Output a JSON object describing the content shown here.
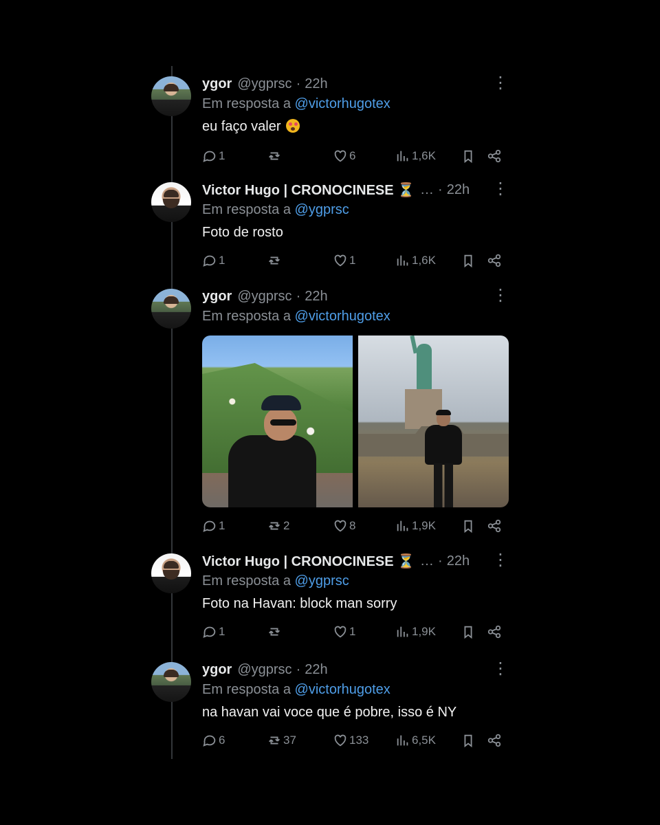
{
  "tweets": [
    {
      "name": "ygor",
      "handle": "@ygprsc",
      "time": "22h",
      "reply_label": "Em resposta a",
      "reply_to": "@victorhugotex",
      "text": "eu faço valer",
      "emoji": "astonished-face",
      "replies": "1",
      "reposts": "",
      "likes": "6",
      "views": "1,6K"
    },
    {
      "name": "Victor Hugo | CRONOCINESE ⏳",
      "handle": "…",
      "time": "22h",
      "reply_label": "Em resposta a",
      "reply_to": "@ygprsc",
      "text": "Foto de rosto",
      "replies": "1",
      "reposts": "",
      "likes": "1",
      "views": "1,6K"
    },
    {
      "name": "ygor",
      "handle": "@ygprsc",
      "time": "22h",
      "reply_label": "Em resposta a",
      "reply_to": "@victorhugotex",
      "replies": "1",
      "reposts": "2",
      "likes": "8",
      "views": "1,9K",
      "images": [
        "man-in-cap-hillside-city",
        "man-in-front-of-statue-of-liberty"
      ]
    },
    {
      "name": "Victor Hugo | CRONOCINESE ⏳",
      "handle": "…",
      "time": "22h",
      "reply_label": "Em resposta a",
      "reply_to": "@ygprsc",
      "text": "Foto na Havan: block man sorry",
      "replies": "1",
      "reposts": "",
      "likes": "1",
      "views": "1,9K"
    },
    {
      "name": "ygor",
      "handle": "@ygprsc",
      "time": "22h",
      "reply_label": "Em resposta a",
      "reply_to": "@victorhugotex",
      "text": "na havan vai voce que é pobre, isso é NY",
      "replies": "6",
      "reposts": "37",
      "likes": "133",
      "views": "6,5K"
    }
  ],
  "colors": {
    "background": "#000000",
    "text": "#e7e9ea",
    "muted": "#8b9096",
    "link": "#4f9ee8"
  }
}
